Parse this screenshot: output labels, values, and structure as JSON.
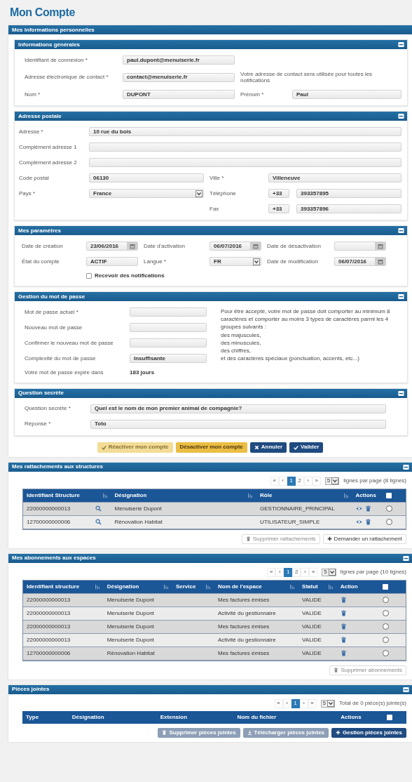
{
  "page_title": "Mon Compte",
  "personal_info": {
    "title": "Mes informations personnelles",
    "sections": [
      {
        "title": "Informations générales",
        "kind": "general",
        "expanded": true,
        "rows": [
          [
            {
              "kind": "label",
              "text": "Identifiant de connexion *"
            },
            {
              "kind": "input",
              "value": "paul.dupont@menuiserie.fr"
            }
          ],
          [
            {
              "kind": "label",
              "text": "Adresse électronique de contact *"
            },
            {
              "kind": "input",
              "value": "contact@menuiserie.fr"
            },
            {
              "kind": "note",
              "text": "Votre adresse de contact sera utilisée pour toutes les notifications"
            }
          ],
          [
            {
              "kind": "label",
              "text": "Nom *"
            },
            {
              "kind": "input",
              "value": "DUPONT"
            },
            {
              "kind": "label",
              "text": "Prénom *"
            },
            {
              "kind": "input",
              "value": "Paul"
            }
          ]
        ]
      },
      {
        "title": "Adresse postale",
        "kind": "address",
        "expanded": true,
        "rows": [
          [
            {
              "kind": "label",
              "text": "Adresse *"
            },
            {
              "kind": "wide-input",
              "value": "10 rue du bois"
            }
          ],
          [
            {
              "kind": "label",
              "text": "Complément adresse 1"
            },
            {
              "kind": "wide-input"
            }
          ],
          [
            {
              "kind": "label",
              "text": "Complément adresse 2"
            },
            {
              "kind": "wide-input"
            }
          ],
          [
            {
              "kind": "label",
              "text": "Code postal"
            },
            {
              "kind": "input",
              "value": "06130"
            },
            {
              "kind": "label",
              "text": "Ville *"
            },
            {
              "kind": "input",
              "value": "Villeneuve"
            }
          ],
          [
            {
              "kind": "label",
              "text": "Pays *"
            },
            {
              "kind": "select",
              "value": "France"
            },
            {
              "kind": "label",
              "text": "Téléphone"
            },
            {
              "kind": "phone",
              "prefix": "+33",
              "value": "393357895"
            }
          ],
          [
            "",
            "",
            {
              "kind": "label",
              "text": "Fax"
            },
            {
              "kind": "phone",
              "prefix": "+33",
              "value": "393357896"
            }
          ]
        ]
      },
      {
        "title": "Mes paramètres",
        "kind": "settings",
        "expanded": true,
        "rows": [
          [
            {
              "kind": "label",
              "text": "Date de création"
            },
            {
              "kind": "date",
              "value": "23/06/2016"
            },
            {
              "kind": "label",
              "text": "Date d'activation"
            },
            {
              "kind": "date",
              "value": "06/07/2016"
            },
            {
              "kind": "label",
              "text": "Date de désactivation"
            },
            {
              "kind": "date"
            }
          ],
          [
            {
              "kind": "label",
              "text": "État du compte"
            },
            {
              "kind": "input",
              "value": "ACTIF"
            },
            {
              "kind": "label",
              "text": "Langue *"
            },
            {
              "kind": "select",
              "value": "FR"
            },
            {
              "kind": "label",
              "text": "Date de modification"
            },
            {
              "kind": "date",
              "value": "06/07/2016"
            }
          ],
          [
            "",
            {
              "kind": "checkbox",
              "text": "Recevoir des notifications",
              "checked": false
            }
          ]
        ]
      },
      {
        "title": "Gestion du mot de passe",
        "kind": "password",
        "expanded": true,
        "note": [
          "Pour être accepté, votre mot de passe doit comporter au minimum 8 caractères et comporter au moins 3 types de caractères parmi les 4 groupes suivants :",
          "des majuscules,",
          "des minuscules,",
          "des chiffres,",
          "et des caractères spéciaux (ponctuation, accents, etc...)"
        ],
        "rows": [
          [
            {
              "kind": "label",
              "text": "Mot de passe actuel *"
            },
            {
              "kind": "input"
            }
          ],
          [
            {
              "kind": "label",
              "text": "Nouveau mot de passe"
            },
            {
              "kind": "input"
            }
          ],
          [
            {
              "kind": "label",
              "text": "Confirmer le nouveau mot de passe"
            },
            {
              "kind": "input"
            }
          ],
          [
            {
              "kind": "label",
              "text": "Complexité du mot de passe"
            },
            {
              "kind": "input",
              "value": "Insuffisante"
            }
          ],
          [
            {
              "kind": "label",
              "text": "Votre mot de passe expire dans"
            },
            {
              "kind": "value",
              "text": "183 jours"
            }
          ]
        ]
      },
      {
        "title": "Question secrète",
        "kind": "question",
        "expanded": true,
        "rows": [
          [
            {
              "kind": "label",
              "text": "Question secrète *"
            },
            {
              "kind": "input",
              "value": "Quel est le nom de mon premier animal de compagnie?"
            }
          ],
          [
            {
              "kind": "label",
              "text": "Réponse *"
            },
            {
              "kind": "input",
              "value": "Toto"
            }
          ]
        ]
      }
    ],
    "buttons": [
      {
        "label": "Réactiver mon compte",
        "kind": "warning-check",
        "disabled": true
      },
      {
        "label": "Désactiver mon compte",
        "kind": "warning",
        "disabled": false
      },
      {
        "label": "Annuler",
        "kind": "cancel",
        "disabled": false
      },
      {
        "label": "Valider",
        "kind": "confirm",
        "disabled": false
      }
    ]
  },
  "tables": [
    {
      "title": "Mes rattachements aux structures",
      "kind": "structures",
      "expanded": true,
      "pager": {
        "pages": [
          {
            "label": "«",
            "selected": false
          },
          {
            "label": "‹",
            "selected": false
          },
          {
            "label": "1",
            "selected": true
          },
          {
            "label": "2",
            "selected": false
          },
          {
            "label": "›",
            "selected": false
          },
          {
            "label": "»",
            "selected": false
          }
        ],
        "per_page": "5",
        "summary": "lignes par page (8 lignes)"
      },
      "columns": [
        {
          "label": "Identifiant Structure",
          "sortable": true
        },
        {
          "label": "Désignation",
          "sortable": true
        },
        {
          "label": "Rôle",
          "sortable": true
        },
        {
          "label": "Actions",
          "sortable": false
        }
      ],
      "select_all": {
        "checked": false
      },
      "rows": [
        {
          "cells": [
            "22000000000013",
            "Menuiserie Dupont",
            "GESTIONNAIRE_PRINCIPAL"
          ],
          "checked": false
        },
        {
          "cells": [
            "12700000000006",
            "Rénovation Habitat",
            "UTILISATEUR_SIMPLE"
          ],
          "checked": false
        }
      ],
      "buttons": [
        {
          "label": "Supprimer rattachements",
          "kind": "delete",
          "disabled": true
        },
        {
          "label": "Demander un rattachement",
          "kind": "add",
          "disabled": false
        }
      ]
    },
    {
      "title": "Mes abonnements aux espaces",
      "kind": "spaces",
      "expanded": true,
      "pager": {
        "pages": [
          {
            "label": "«",
            "selected": false
          },
          {
            "label": "‹",
            "selected": false
          },
          {
            "label": "1",
            "selected": true
          },
          {
            "label": "2",
            "selected": false
          },
          {
            "label": "›",
            "selected": false
          },
          {
            "label": "»",
            "selected": false
          }
        ],
        "per_page": "5",
        "summary": "lignes par page (10 lignes)"
      },
      "columns": [
        {
          "label": "Identifiant structure",
          "sortable": true
        },
        {
          "label": "Désignation",
          "sortable": true
        },
        {
          "label": "Service",
          "sortable": true
        },
        {
          "label": "Nom de l'espace",
          "sortable": true
        },
        {
          "label": "Statut",
          "sortable": true
        },
        {
          "label": "Action",
          "sortable": false
        }
      ],
      "select_all": {
        "checked": false
      },
      "rows": [
        {
          "cells": [
            "22000000000013",
            "Menuiserie Dupont",
            "",
            "Mes factures émises",
            "VALIDE"
          ],
          "checked": false
        },
        {
          "cells": [
            "22000000000013",
            "Menuiserie Dupont",
            "",
            "Activité du gestionnaire",
            "VALIDE"
          ],
          "checked": false
        },
        {
          "cells": [
            "22000000000013",
            "Menuiserie Dupont",
            "",
            "Mes factures émises",
            "VALIDE"
          ],
          "checked": false
        },
        {
          "cells": [
            "22000000000013",
            "Menuiserie Dupont",
            "",
            "Activité du gestionnaire",
            "VALIDE"
          ],
          "checked": false
        },
        {
          "cells": [
            "12700000000006",
            "Rénovation Habitat",
            "",
            "Mes factures émises",
            "VALIDE"
          ],
          "checked": false
        }
      ],
      "buttons": [
        {
          "label": "Supprimer abonnements",
          "kind": "delete",
          "disabled": true
        }
      ]
    },
    {
      "title": "Pièces jointes",
      "kind": "files",
      "expanded": true,
      "pager": {
        "pages": [
          {
            "label": "«",
            "selected": false
          },
          {
            "label": "‹",
            "selected": false
          },
          {
            "label": "1",
            "selected": true
          },
          {
            "label": "›",
            "selected": false
          },
          {
            "label": "»",
            "selected": false
          }
        ],
        "per_page": "5",
        "summary": "Total de 0 pièce(s) jointe(s)"
      },
      "columns": [
        {
          "label": "Type",
          "sortable": false
        },
        {
          "label": "Désignation",
          "sortable": false
        },
        {
          "label": "Extension",
          "sortable": false
        },
        {
          "label": "Nom du fichier",
          "sortable": false
        },
        {
          "label": "Actions",
          "sortable": false
        }
      ],
      "select_all": {
        "checked": false
      },
      "buttons": [
        {
          "label": "Supprimer pièces jointes",
          "kind": "delete-solid",
          "disabled": true
        },
        {
          "label": "Télécharger pièces jointes",
          "kind": "download-solid",
          "disabled": true
        },
        {
          "label": "Gestion pièces jointes",
          "kind": "add-solid",
          "disabled": false
        }
      ]
    }
  ]
}
